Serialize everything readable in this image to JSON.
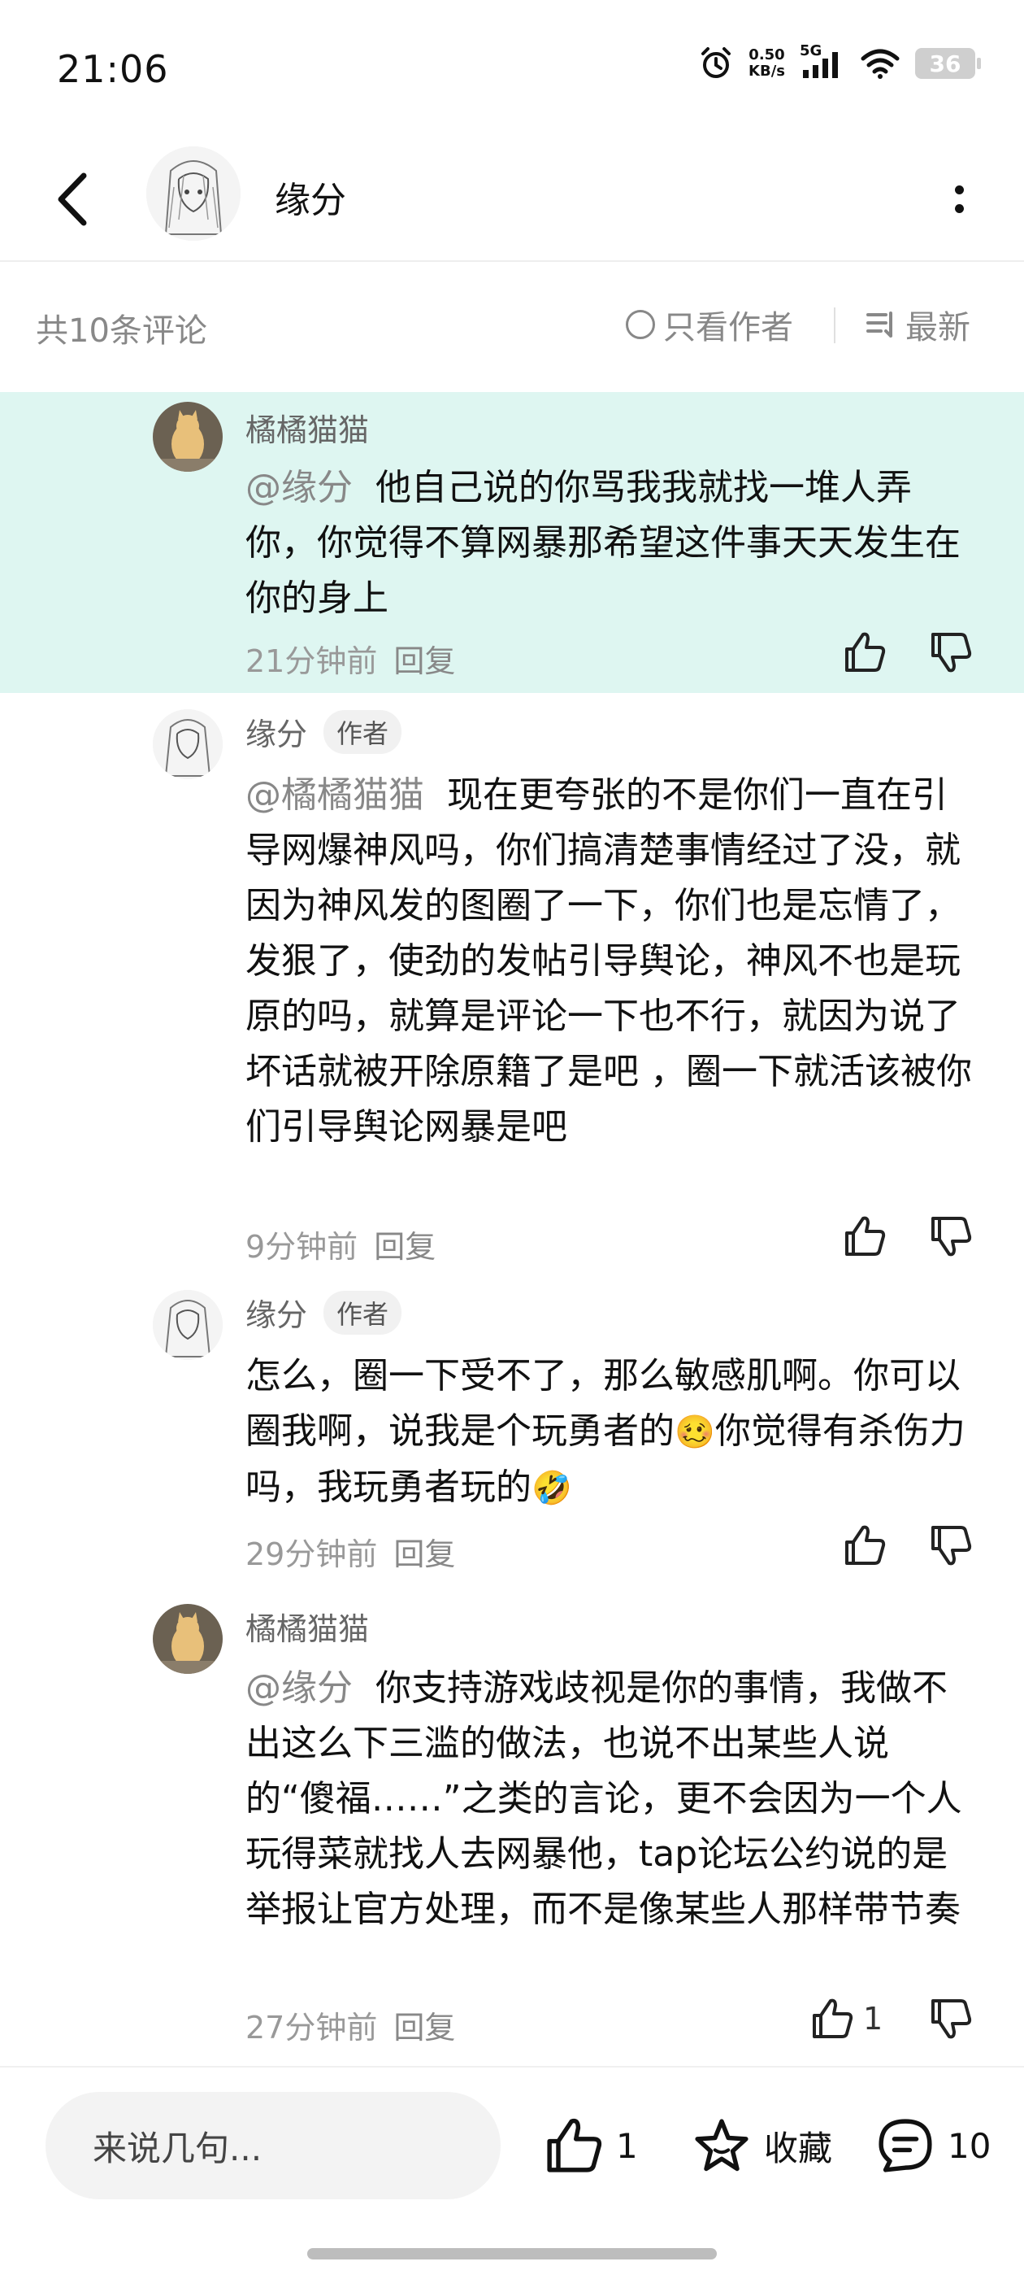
{
  "status_bar": {
    "time": "21:06",
    "net_speed_value": "0.50",
    "net_speed_unit": "KB/s",
    "signal": "5G",
    "battery": "36"
  },
  "header": {
    "title": "缘分"
  },
  "filter": {
    "count_text": "共10条评论",
    "only_author": "只看作者",
    "sort_label": "最新"
  },
  "comments": [
    {
      "user": "橘橘猫猫",
      "mention": "@缘分",
      "text": "他自己说的你骂我我就找一堆人弄你，你觉得不算网暴那希望这件事天天发生在你的身上",
      "time": "21分钟前",
      "reply": "回复"
    },
    {
      "user": "缘分",
      "tag": "作者",
      "mention": "@橘橘猫猫",
      "text": "现在更夸张的不是你们一直在引导网爆神风吗，你们搞清楚事情经过了没，就因为神风发的图圈了一下，你们也是忘情了，发狠了，使劲的发帖引导舆论，神风不也是玩原的吗，就算是评论一下也不行，就因为说了坏话就被开除原籍了是吧 ，圈一下就活该被你们引导舆论网暴是吧",
      "time": "9分钟前",
      "reply": "回复"
    },
    {
      "user": "缘分",
      "tag": "作者",
      "text_a": "怎么，圈一下受不了，那么敏感肌啊。你可以圈我啊，说我是个玩勇者的",
      "emoji_a": "🥴",
      "text_b": "你觉得有杀伤力吗，我玩勇者玩的",
      "emoji_b": "🤣",
      "time": "29分钟前",
      "reply": "回复"
    },
    {
      "user": "橘橘猫猫",
      "mention": "@缘分",
      "text": "你支持游戏歧视是你的事情，我做不出这么下三滥的做法，也说不出某些人说的“傻福……”之类的言论，更不会因为一个人玩得菜就找人去网暴他，tap论坛公约说的是举报让官方处理，而不是像某些人那样带节奏",
      "time": "27分钟前",
      "reply": "回复",
      "likes": "1"
    }
  ],
  "bottom_bar": {
    "input_placeholder": "来说几句...",
    "like_count": "1",
    "favorite_label": "收藏",
    "comment_count": "10"
  },
  "icons": {
    "back": "chevron-left-icon",
    "more": "more-vertical-icon",
    "like": "thumbs-up-icon",
    "dislike": "thumbs-down-icon",
    "favorite": "star-icon",
    "comment": "comment-bubble-icon"
  },
  "colors": {
    "highlight_bg": "#def6f1",
    "secondary_text": "#888888"
  }
}
